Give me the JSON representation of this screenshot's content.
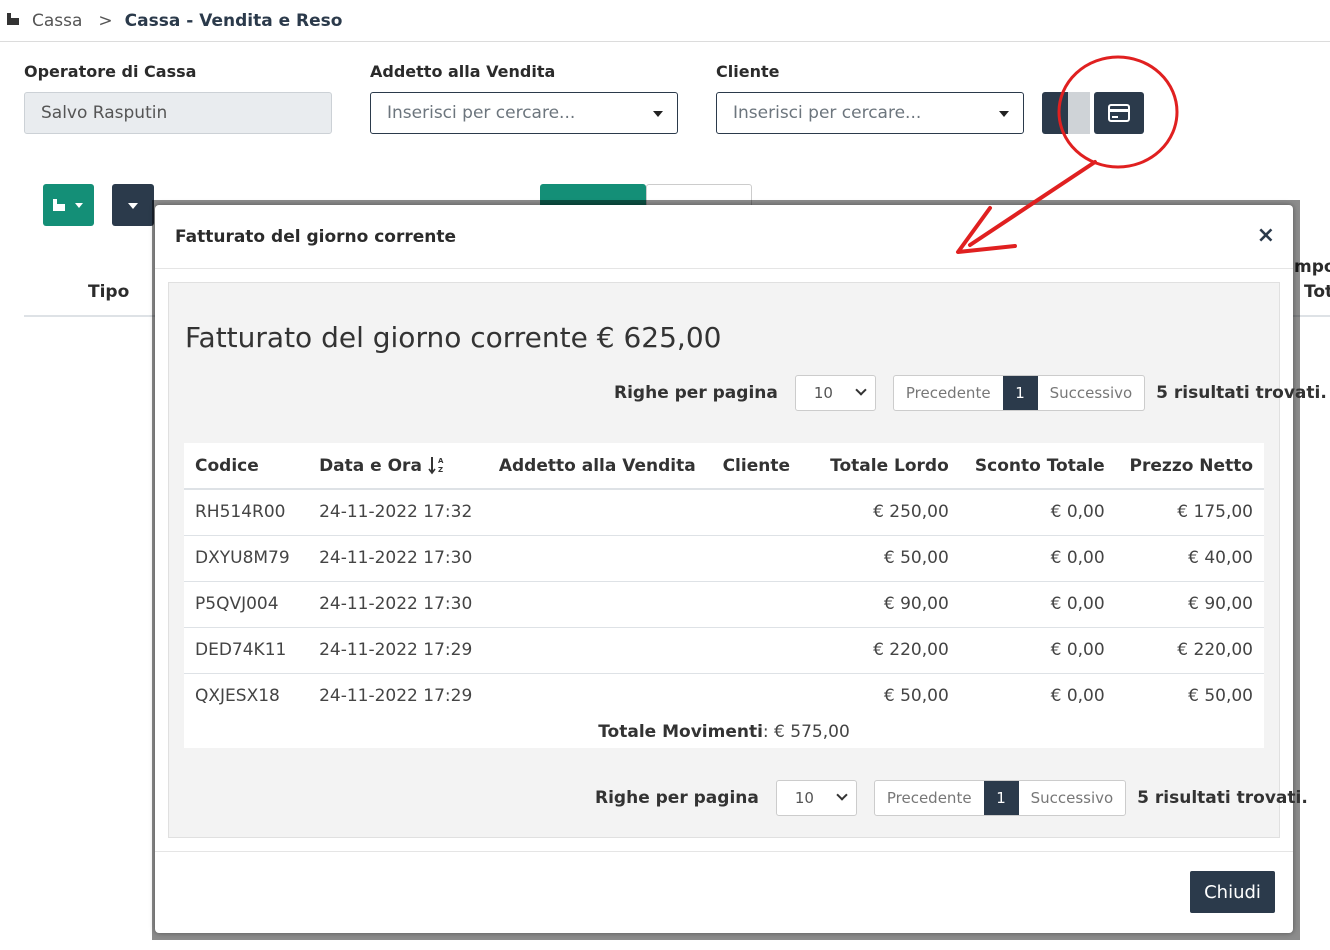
{
  "breadcrumb": {
    "home": "Cassa",
    "separator": ">",
    "current": "Cassa - Vendita e Reso"
  },
  "form": {
    "operatore_label": "Operatore di Cassa",
    "operatore_value": "Salvo Rasputin",
    "addetto_label": "Addetto alla Vendita",
    "addetto_placeholder": "Inserisci per cercare...",
    "cliente_label": "Cliente",
    "cliente_placeholder": "Inserisci per cercare..."
  },
  "background": {
    "tipo_header": "Tipo",
    "impo_header": "mpo",
    "tot_header": "Tot"
  },
  "modal": {
    "header_title": "Fatturato del giorno corrente",
    "big_title": "Fatturato del giorno corrente € 625,00",
    "close_label": "Chiudi",
    "close_x": "×",
    "pager": {
      "rows_label": "Righe per pagina",
      "rows_value": "10",
      "prev": "Precedente",
      "page": "1",
      "next": "Successivo",
      "results": "5 risultati trovati."
    },
    "table": {
      "headers": [
        "Codice",
        "Data e Ora",
        "Addetto alla Vendita",
        "Cliente",
        "Totale Lordo",
        "Sconto Totale",
        "Prezzo Netto"
      ],
      "rows": [
        [
          "RH514R00",
          "24-11-2022 17:32",
          "",
          "",
          "€ 250,00",
          "€ 0,00",
          "€ 175,00"
        ],
        [
          "DXYU8M79",
          "24-11-2022 17:30",
          "",
          "",
          "€ 50,00",
          "€ 0,00",
          "€ 40,00"
        ],
        [
          "P5QVJ004",
          "24-11-2022 17:30",
          "",
          "",
          "€ 90,00",
          "€ 0,00",
          "€ 90,00"
        ],
        [
          "DED74K11",
          "24-11-2022 17:29",
          "",
          "",
          "€ 220,00",
          "€ 0,00",
          "€ 220,00"
        ],
        [
          "QXJESX18",
          "24-11-2022 17:29",
          "",
          "",
          "€ 50,00",
          "€ 0,00",
          "€ 50,00"
        ]
      ],
      "totale_label": "Totale Movimenti",
      "totale_value": ": € 575,00"
    }
  },
  "colors": {
    "primary": "#2b3a4b",
    "success": "#148f77",
    "annotation": "#e02020"
  }
}
